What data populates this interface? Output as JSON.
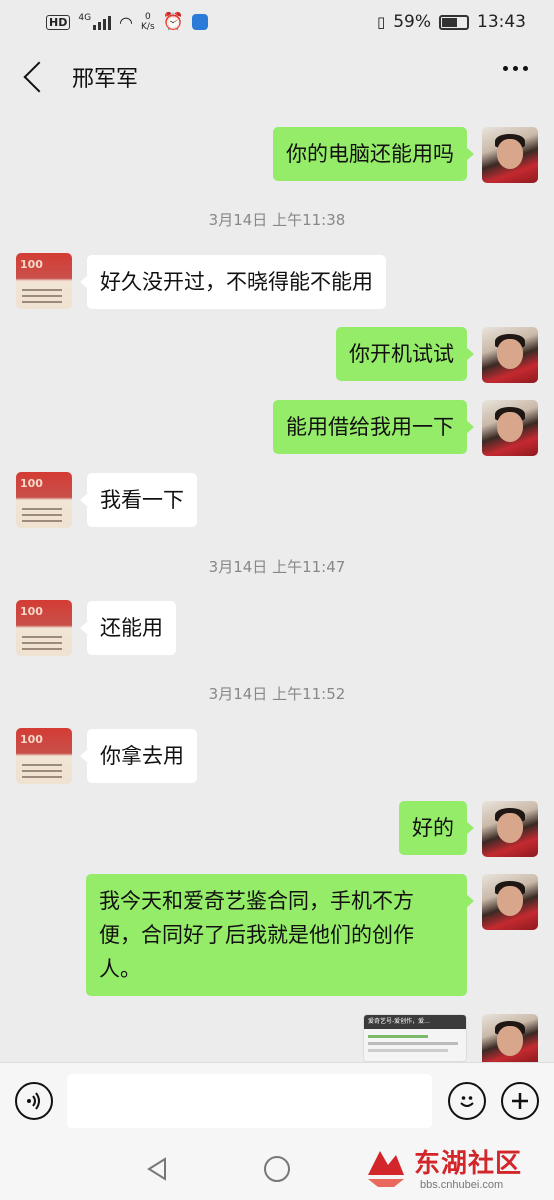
{
  "status_bar": {
    "hd": "HD",
    "net_type": "4G",
    "speed_value": "0",
    "speed_unit": "K/s",
    "battery": "59%",
    "time": "13:43"
  },
  "header": {
    "title": "邢军军"
  },
  "messages": [
    {
      "from": "self",
      "text": "你的电脑还能用吗"
    },
    {
      "type": "time",
      "text": "3月14日 上午11:38"
    },
    {
      "from": "other",
      "text": "好久没开过，不晓得能不能用"
    },
    {
      "from": "self",
      "text": "你开机试试"
    },
    {
      "from": "self",
      "text": "能用借给我用一下"
    },
    {
      "from": "other",
      "text": "我看一下"
    },
    {
      "type": "time",
      "text": "3月14日 上午11:47"
    },
    {
      "from": "other",
      "text": "还能用"
    },
    {
      "type": "time",
      "text": "3月14日 上午11:52"
    },
    {
      "from": "other",
      "text": "你拿去用"
    },
    {
      "from": "self",
      "text": "好的"
    },
    {
      "from": "self",
      "text": "我今天和爱奇艺鉴合同，手机不方便，合同好了后我就是他们的创作人。"
    },
    {
      "from": "self",
      "type": "image",
      "text": "爱奇艺号-爱创作，爱..."
    }
  ],
  "watermark": {
    "name": "东湖社区",
    "url": "bbs.cnhubei.com"
  },
  "colors": {
    "self_bubble": "#95ec69",
    "other_bubble": "#ffffff",
    "background": "#ececec"
  }
}
